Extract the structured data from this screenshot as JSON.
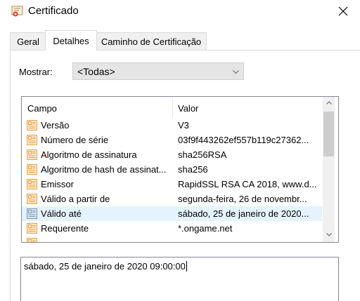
{
  "window": {
    "title": "Certificado",
    "close_icon": "close-icon"
  },
  "tabs": [
    {
      "label": "Geral"
    },
    {
      "label": "Detalhes"
    },
    {
      "label": "Caminho de Certificação"
    }
  ],
  "active_tab": "Detalhes",
  "filter": {
    "label": "Mostrar:",
    "selected": "<Todas>"
  },
  "list": {
    "columns": {
      "field": "Campo",
      "value": "Valor"
    },
    "rows": [
      {
        "field": "Versão",
        "value": "V3",
        "icon": "field-document-icon"
      },
      {
        "field": "Número de série",
        "value": "03f9f443262ef557b119c27362...",
        "icon": "field-document-icon"
      },
      {
        "field": "Algoritmo de assinatura",
        "value": "sha256RSA",
        "icon": "field-document-icon"
      },
      {
        "field": "Algoritmo de hash de assinat...",
        "value": "sha256",
        "icon": "field-document-icon"
      },
      {
        "field": "Emissor",
        "value": "RapidSSL RSA CA 2018, www.d...",
        "icon": "field-document-icon"
      },
      {
        "field": "Válido a partir de",
        "value": "segunda-feira, 26 de novembr...",
        "icon": "field-document-icon"
      },
      {
        "field": "Válido até",
        "value": "sábado, 25 de janeiro de 2020...",
        "icon": "field-document-icon",
        "selected": true
      },
      {
        "field": "Requerente",
        "value": "*.ongame.net",
        "icon": "field-document-icon"
      }
    ]
  },
  "detail": {
    "text": "sábado, 25 de janeiro de 2020 09:00:00"
  },
  "colors": {
    "selection": "#e5f3ff",
    "icon_orange": "#e8a24a",
    "icon_blue_gray": "#7a98b0"
  }
}
